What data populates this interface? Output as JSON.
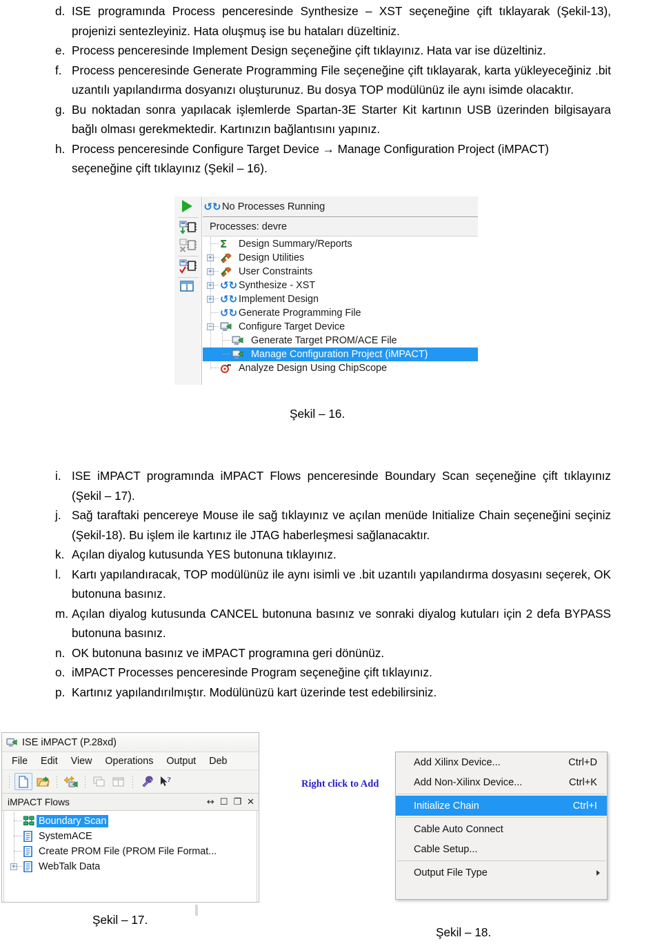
{
  "document": {
    "items": [
      {
        "marker": "d.",
        "text": "ISE programında Process penceresinde Synthesize – XST seçeneğine çift tıklayarak (Şekil-13), projenizi sentezleyiniz. Hata oluşmuş ise bu hataları düzeltiniz."
      },
      {
        "marker": "e.",
        "text": "Process penceresinde Implement Design seçeneğine çift tıklayınız. Hata var ise düzeltiniz."
      },
      {
        "marker": "f.",
        "text": "Process penceresinde Generate Programming File seçeneğine çift tıklayarak, karta yükleyeceğiniz .bit uzantılı yapılandırma dosyanızı oluşturunuz. Bu dosya TOP modülünüz ile aynı isimde olacaktır."
      },
      {
        "marker": "g.",
        "text": "Bu noktadan sonra yapılacak işlemlerde Spartan-3E Starter Kit kartının USB üzerinden bilgisayara bağlı olması gerekmektedir. Kartınızın bağlantısını yapınız."
      },
      {
        "marker": "h.",
        "text": "Process penceresinde Configure Target Device → Manage Configuration Project (iMPACT) seçeneğine çift tıklayınız (Şekil – 16)."
      }
    ],
    "items2": [
      {
        "marker": "i.",
        "text": "ISE iMPACT programında iMPACT Flows penceresinde Boundary Scan seçeneğine çift tıklayınız (Şekil – 17)."
      },
      {
        "marker": "j.",
        "text": "Sağ taraftaki pencereye Mouse ile sağ tıklayınız ve açılan menüde Initialize Chain seçeneğini seçiniz (Şekil-18). Bu işlem ile kartınız ile JTAG haberleşmesi sağlanacaktır."
      },
      {
        "marker": "k.",
        "text": "Açılan diyalog kutusunda YES butonuna tıklayınız."
      },
      {
        "marker": "l.",
        "text": "Kartı yapılandıracak, TOP modülünüz ile aynı isimli ve .bit uzantılı yapılandırma dosyasını seçerek, OK butonuna basınız."
      },
      {
        "marker": "m.",
        "text": "Açılan diyalog kutusunda CANCEL butonuna basınız ve sonraki diyalog kutuları için 2 defa BYPASS butonuna basınız."
      },
      {
        "marker": "n.",
        "text": "OK butonuna basınız ve iMPACT programına geri dönünüz."
      },
      {
        "marker": "o.",
        "text": "iMPACT Processes penceresinde Program seçeneğine çift tıklayınız."
      },
      {
        "marker": "p.",
        "text": "Kartınız yapılandırılmıştır. Modülünüzü kart üzerinde test edebilirsiniz."
      }
    ],
    "captions": {
      "fig16": "Şekil – 16.",
      "fig17": "Şekil – 17.",
      "fig18": "Şekil – 18."
    }
  },
  "fig16": {
    "status_bar": "No Processes Running",
    "processes_header": "Processes: devre",
    "tree": [
      {
        "label": "Design Summary/Reports",
        "expander": "",
        "icon": "sigma-icon",
        "level": 0,
        "selected": false
      },
      {
        "label": "Design Utilities",
        "expander": "+",
        "icon": "tools-icon",
        "level": 0,
        "selected": false
      },
      {
        "label": "User Constraints",
        "expander": "+",
        "icon": "tools-icon",
        "level": 0,
        "selected": false
      },
      {
        "label": "Synthesize - XST",
        "expander": "+",
        "icon": "recycle-icon",
        "level": 0,
        "selected": false
      },
      {
        "label": "Implement Design",
        "expander": "+",
        "icon": "recycle-icon",
        "level": 0,
        "selected": false
      },
      {
        "label": "Generate Programming File",
        "expander": "",
        "icon": "recycle-icon",
        "level": 0,
        "selected": false
      },
      {
        "label": "Configure Target Device",
        "expander": "−",
        "icon": "device-icon",
        "level": 0,
        "selected": false
      },
      {
        "label": "Generate Target PROM/ACE File",
        "expander": "",
        "icon": "device-icon",
        "level": 1,
        "selected": false
      },
      {
        "label": "Manage Configuration Project (iMPACT)",
        "expander": "",
        "icon": "device-icon",
        "level": 1,
        "selected": true
      },
      {
        "label": "Analyze Design Using ChipScope",
        "expander": "",
        "icon": "chipscope-icon",
        "level": 0,
        "selected": false
      }
    ],
    "rail_buttons": [
      "run-button",
      "implement-top-module-button",
      "cancel-process-button",
      "rerun-all-button",
      "view-panel-button"
    ],
    "colors": {
      "selection": "#2196f3",
      "run_green": "#1faa27",
      "recycle_blue": "#1976d2",
      "sigma_green": "#2e7d32"
    }
  },
  "fig17": {
    "title": "ISE iMPACT (P.28xd)",
    "menus": [
      "File",
      "Edit",
      "View",
      "Operations",
      "Output",
      "Deb"
    ],
    "toolbar_buttons": [
      "new-file-icon",
      "open-file-icon",
      "add-device-icon",
      "cascade-icon",
      "tile-icon",
      "wrench-icon",
      "context-help-icon"
    ],
    "pane_title": "iMPACT Flows",
    "pane_controls": [
      "resize-icon",
      "maximize-icon",
      "restore-icon",
      "close-icon"
    ],
    "flows": [
      {
        "label": "Boundary Scan",
        "icon": "chain-icon",
        "expander": "",
        "selected": true
      },
      {
        "label": "SystemACE",
        "icon": "document-icon",
        "expander": "",
        "selected": false
      },
      {
        "label": "Create PROM File (PROM File Format...",
        "icon": "document-icon",
        "expander": "",
        "selected": false
      },
      {
        "label": "WebTalk Data",
        "icon": "document-icon",
        "expander": "+",
        "selected": false
      }
    ],
    "colors": {
      "selection": "#2196f3"
    }
  },
  "fig18": {
    "hint_text": "Right click to Add",
    "hint_color": "#2a20c8",
    "menu_items": [
      {
        "label": "Add Xilinx Device...",
        "accel": "Ctrl+D",
        "selected": false,
        "submenu": false
      },
      {
        "label": "Add Non-Xilinx Device...",
        "accel": "Ctrl+K",
        "selected": false,
        "submenu": false
      },
      {
        "separator": true
      },
      {
        "label": "Initialize Chain",
        "accel": "Ctrl+I",
        "selected": true,
        "submenu": false
      },
      {
        "separator": true
      },
      {
        "label": "Cable Auto Connect",
        "accel": "",
        "selected": false,
        "submenu": false
      },
      {
        "label": "Cable Setup...",
        "accel": "",
        "selected": false,
        "submenu": false
      },
      {
        "separator": true
      },
      {
        "label": "Output File Type",
        "accel": "",
        "selected": false,
        "submenu": true
      }
    ],
    "colors": {
      "selection": "#2196f3"
    }
  }
}
